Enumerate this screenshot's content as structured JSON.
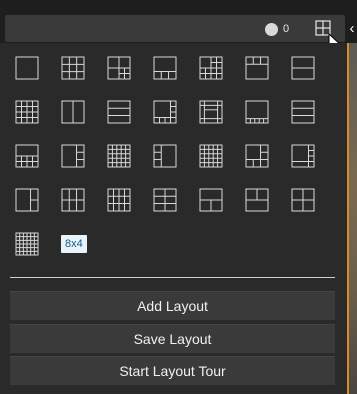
{
  "header": {
    "indicator_value": "0",
    "indicator_icon": "circle-indicator-icon",
    "layout_icon": "grid-layout-icon",
    "collapse_icon": "chevron-left-icon",
    "collapse_glyph": "‹"
  },
  "layouts": [
    {
      "name": "layout-1x1",
      "icon": "layout-1x1-icon"
    },
    {
      "name": "layout-3x3",
      "icon": "layout-3x3-icon"
    },
    {
      "name": "layout-1p5",
      "icon": "layout-1p5-icon"
    },
    {
      "name": "layout-1p3-bottom",
      "icon": "layout-1p3-bottom-icon"
    },
    {
      "name": "layout-2x2-4x4",
      "icon": "layout-2x2-4x4-icon"
    },
    {
      "name": "layout-1p3-top",
      "icon": "layout-1p3-top-icon"
    },
    {
      "name": "layout-2-rows",
      "icon": "layout-2-rows-icon"
    },
    {
      "name": "layout-4x4",
      "icon": "layout-4x4-icon"
    },
    {
      "name": "layout-2-cols",
      "icon": "layout-2-cols-icon"
    },
    {
      "name": "layout-3-rows",
      "icon": "layout-3-rows-icon"
    },
    {
      "name": "layout-1p7",
      "icon": "layout-1p7-icon"
    },
    {
      "name": "layout-1p12",
      "icon": "layout-1p12-icon"
    },
    {
      "name": "layout-1p5-bottom",
      "icon": "layout-1p5-bottom-icon"
    },
    {
      "name": "layout-3-rows-b",
      "icon": "layout-3-rows-b-icon"
    },
    {
      "name": "layout-1p4-bottom",
      "icon": "layout-1p4-bottom-icon"
    },
    {
      "name": "layout-1p3-right",
      "icon": "layout-1p3-right-icon"
    },
    {
      "name": "layout-1p16",
      "icon": "layout-1p16-icon"
    },
    {
      "name": "layout-1p3-left",
      "icon": "layout-1p3-left-icon"
    },
    {
      "name": "layout-5x5",
      "icon": "layout-5x5-icon"
    },
    {
      "name": "layout-1p9",
      "icon": "layout-1p9-icon"
    },
    {
      "name": "layout-1p7-right",
      "icon": "layout-1p7-right-icon"
    },
    {
      "name": "layout-1p2-right",
      "icon": "layout-1p2-right-icon"
    },
    {
      "name": "layout-2x3",
      "icon": "layout-2x3-icon"
    },
    {
      "name": "layout-3x4",
      "icon": "layout-3x4-icon"
    },
    {
      "name": "layout-2x3-b",
      "icon": "layout-2x3-b-icon"
    },
    {
      "name": "layout-1p2-bottom",
      "icon": "layout-1p2-bottom-icon"
    },
    {
      "name": "layout-1p2-top",
      "icon": "layout-1p2-top-icon"
    },
    {
      "name": "layout-2x2",
      "icon": "layout-2x2-icon"
    },
    {
      "name": "layout-6x6",
      "icon": "layout-6x6-icon"
    }
  ],
  "layout_8x4": {
    "label": "8x4"
  },
  "actions": {
    "add_layout": "Add Layout",
    "save_layout": "Save Layout",
    "start_tour": "Start Layout Tour"
  },
  "colors": {
    "panel_bg": "#2a2a2a",
    "icon_stroke": "#d9d9d9",
    "badge_bg": "#e8f3fa",
    "badge_fg": "#1a5a8a",
    "accent_orange": "#d98a2b"
  }
}
